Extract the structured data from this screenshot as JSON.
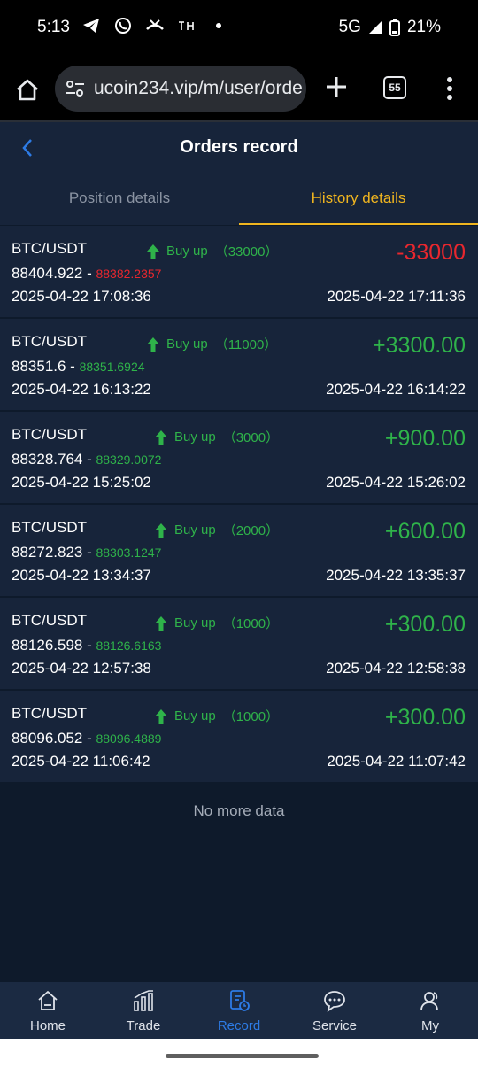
{
  "status_bar": {
    "time": "5:13",
    "network": "5G",
    "battery": "21%"
  },
  "browser": {
    "url": "ucoin234.vip/m/user/orde",
    "tab_count": "55"
  },
  "header": {
    "title": "Orders record"
  },
  "tabs": {
    "position": "Position details",
    "history": "History details"
  },
  "orders": [
    {
      "pair": "BTC/USDT",
      "direction": "Buy up",
      "amount": "（33000）",
      "open_price": "88404.922",
      "separator": " - ",
      "close_price": "88382.2357",
      "close_status": "loss",
      "open_time": "2025-04-22 17:08:36",
      "pnl": "-33000",
      "pnl_status": "loss",
      "close_time": "2025-04-22 17:11:36"
    },
    {
      "pair": "BTC/USDT",
      "direction": "Buy up",
      "amount": "（11000）",
      "open_price": "88351.6",
      "separator": " - ",
      "close_price": "88351.6924",
      "close_status": "gain",
      "open_time": "2025-04-22 16:13:22",
      "pnl": "+3300.00",
      "pnl_status": "gain",
      "close_time": "2025-04-22 16:14:22"
    },
    {
      "pair": "BTC/USDT",
      "direction": "Buy up",
      "amount": "（3000）",
      "open_price": "88328.764",
      "separator": " - ",
      "close_price": "88329.0072",
      "close_status": "gain",
      "open_time": "2025-04-22 15:25:02",
      "pnl": "+900.00",
      "pnl_status": "gain",
      "close_time": "2025-04-22 15:26:02"
    },
    {
      "pair": "BTC/USDT",
      "direction": "Buy up",
      "amount": "（2000）",
      "open_price": "88272.823",
      "separator": " - ",
      "close_price": "88303.1247",
      "close_status": "gain",
      "open_time": "2025-04-22 13:34:37",
      "pnl": "+600.00",
      "pnl_status": "gain",
      "close_time": "2025-04-22 13:35:37"
    },
    {
      "pair": "BTC/USDT",
      "direction": "Buy up",
      "amount": "（1000）",
      "open_price": "88126.598",
      "separator": " - ",
      "close_price": "88126.6163",
      "close_status": "gain",
      "open_time": "2025-04-22 12:57:38",
      "pnl": "+300.00",
      "pnl_status": "gain",
      "close_time": "2025-04-22 12:58:38"
    },
    {
      "pair": "BTC/USDT",
      "direction": "Buy up",
      "amount": "（1000）",
      "open_price": "88096.052",
      "separator": " - ",
      "close_price": "88096.4889",
      "close_status": "gain",
      "open_time": "2025-04-22 11:06:42",
      "pnl": "+300.00",
      "pnl_status": "gain",
      "close_time": "2025-04-22 11:07:42"
    }
  ],
  "footer_text": "No more data",
  "nav": [
    {
      "label": "Home",
      "icon": "home-icon"
    },
    {
      "label": "Trade",
      "icon": "trade-icon"
    },
    {
      "label": "Record",
      "icon": "record-icon",
      "active": true
    },
    {
      "label": "Service",
      "icon": "service-icon"
    },
    {
      "label": "My",
      "icon": "user-icon"
    }
  ],
  "colors": {
    "background": "#0e1a2b",
    "card": "#17243a",
    "accent": "#f0b51f",
    "gain": "#2fb34a",
    "loss": "#e8272e",
    "nav_active": "#2d7be5"
  }
}
